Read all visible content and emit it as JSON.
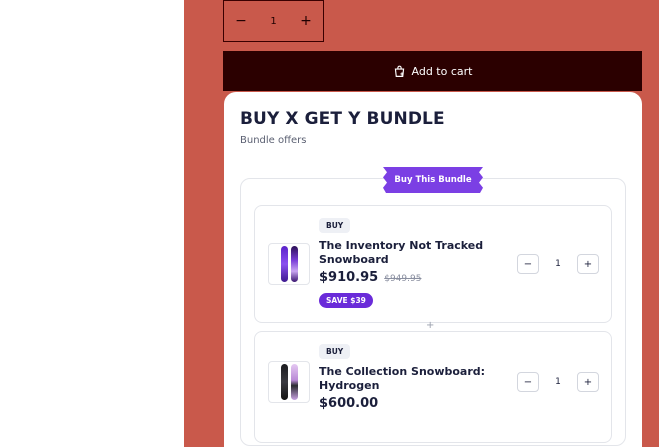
{
  "product": {
    "quantity": "1",
    "add_to_cart_label": "Add to cart"
  },
  "bundle": {
    "title": "BUY X GET Y BUNDLE",
    "subtitle": "Bundle offers",
    "ribbon_label": "Buy This Bundle",
    "separator": "+",
    "items": [
      {
        "badge": "BUY",
        "name": "The Inventory Not Tracked Snowboard",
        "price": "$910.95",
        "compare_price": "$949.95",
        "save_label": "SAVE $39",
        "quantity": "1",
        "image_icon": "snowboard-purple-icon"
      },
      {
        "badge": "BUY",
        "name": "The Collection Snowboard: Hydrogen",
        "price": "$600.00",
        "quantity": "1",
        "image_icon": "snowboard-black-icon"
      }
    ]
  },
  "colors": {
    "panel_background": "#c9594b",
    "add_to_cart_background": "#2b0000",
    "accent_purple": "#7b3fe4",
    "save_badge": "#6a2bd9"
  }
}
